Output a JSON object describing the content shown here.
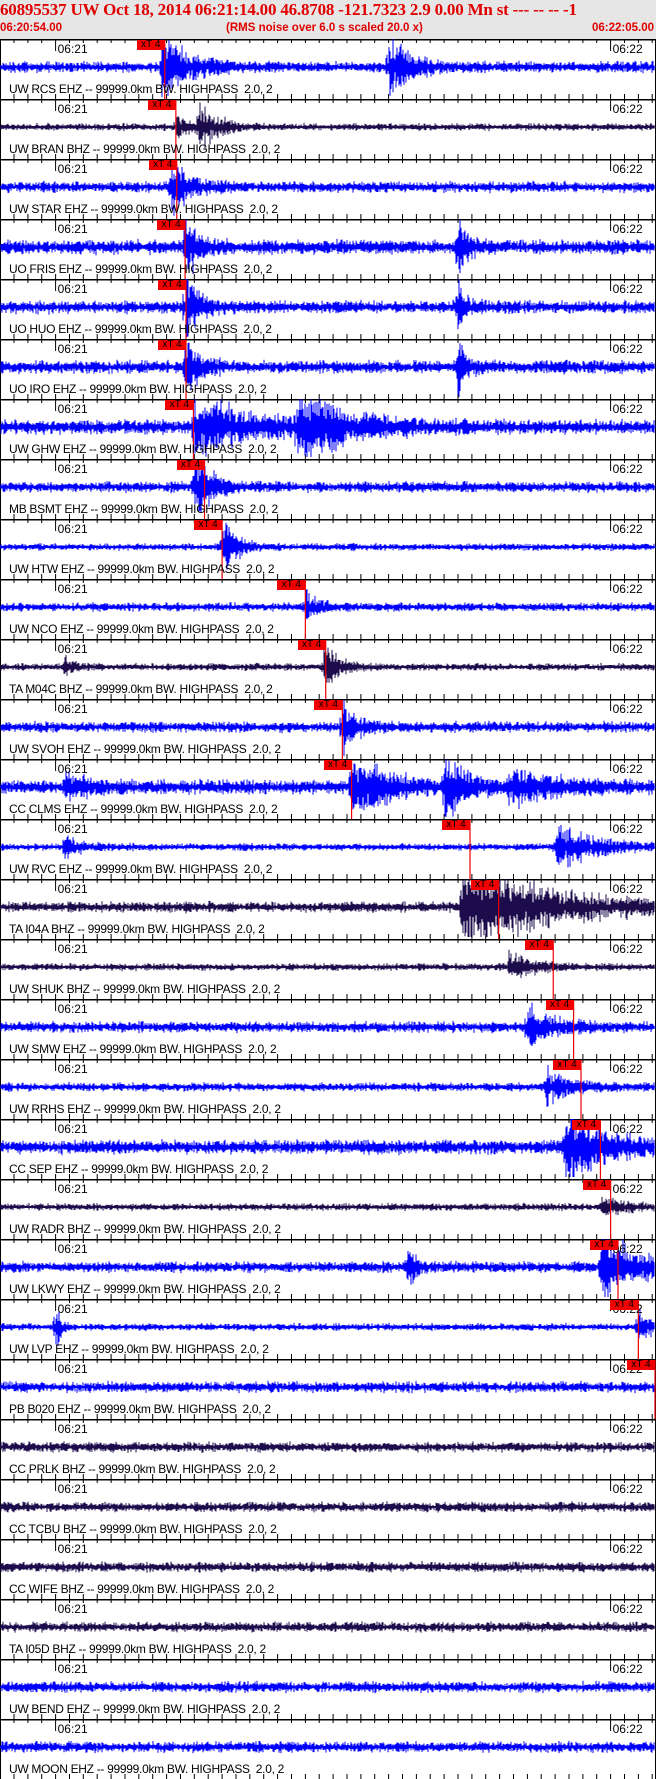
{
  "header": {
    "title": "60895537 UW Oct 18, 2014 06:21:14.00   46.8708 -121.7323  2.9 0.00 Mn st --- -- --  -1",
    "start_time": "06:20:54.00",
    "note": "(RMS noise over 6.0 s scaled 20.0 x)",
    "end_time": "06:22:05.00"
  },
  "chart_data": {
    "type": "line",
    "title": "60895537 UW Oct 18, 2014 06:21:14.00",
    "x_unit": "seconds after 06:20:54.00",
    "xlim": [
      0,
      71
    ],
    "tick_labels": [
      {
        "label": "06:21",
        "t": 6
      },
      {
        "label": "06:22",
        "t": 66
      }
    ],
    "pick_label": "xT 4",
    "colors": {
      "EHZ": "#0000ff",
      "BHZ": "#1c0c4c",
      "pick": "#f00000"
    },
    "suffix": " -- 99999.0km BW. HIGHPASS  2.0, 2",
    "traces": [
      {
        "station": "UW RCS EHZ",
        "ch": "EHZ",
        "pick": 17.8,
        "noise": 0.15,
        "events": [
          [
            17.5,
            1.0,
            6
          ],
          [
            42,
            0.8,
            5
          ]
        ]
      },
      {
        "station": "UW BRAN BHZ",
        "ch": "BHZ",
        "pick": 19.0,
        "noise": 0.1,
        "events": [
          [
            19,
            0.3,
            4
          ],
          [
            21.5,
            0.7,
            4
          ]
        ]
      },
      {
        "station": "UW STAR EHZ",
        "ch": "EHZ",
        "pick": 19.1,
        "noise": 0.15,
        "events": [
          [
            18.5,
            0.9,
            4
          ]
        ]
      },
      {
        "station": "UO FRIS EHZ",
        "ch": "EHZ",
        "pick": 20.0,
        "noise": 0.2,
        "events": [
          [
            20,
            1.0,
            3
          ],
          [
            49.5,
            0.8,
            2
          ]
        ]
      },
      {
        "station": "UO HUO EHZ",
        "ch": "EHZ",
        "pick": 20.1,
        "noise": 0.18,
        "events": [
          [
            20,
            1.0,
            3
          ],
          [
            49.5,
            0.7,
            2
          ]
        ]
      },
      {
        "station": "UO IRO EHZ",
        "ch": "EHZ",
        "pick": 20.1,
        "noise": 0.18,
        "events": [
          [
            20,
            1.0,
            3
          ],
          [
            49.5,
            1.0,
            2
          ]
        ]
      },
      {
        "station": "UW GHW EHZ",
        "ch": "EHZ",
        "pick": 20.9,
        "noise": 0.2,
        "events": [
          [
            21,
            0.9,
            12
          ],
          [
            32,
            0.9,
            12
          ]
        ]
      },
      {
        "station": "MB BSMT EHZ",
        "ch": "EHZ",
        "pick": 22.1,
        "noise": 0.15,
        "events": [
          [
            21,
            1.0,
            4
          ]
        ]
      },
      {
        "station": "UW HTW EHZ",
        "ch": "EHZ",
        "pick": 24.0,
        "noise": 0.1,
        "events": [
          [
            24,
            0.8,
            3
          ]
        ]
      },
      {
        "station": "UW NCO EHZ",
        "ch": "EHZ",
        "pick": 33.0,
        "noise": 0.12,
        "events": [
          [
            33,
            0.4,
            3
          ]
        ]
      },
      {
        "station": "TA M04C BHZ",
        "ch": "BHZ",
        "pick": 35.2,
        "noise": 0.1,
        "events": [
          [
            7,
            0.3,
            2
          ],
          [
            35,
            0.7,
            3
          ]
        ]
      },
      {
        "station": "UW SVOH EHZ",
        "ch": "EHZ",
        "pick": 37.0,
        "noise": 0.15,
        "events": [
          [
            37,
            0.6,
            4
          ]
        ]
      },
      {
        "station": "CC CLMS EHZ",
        "ch": "EHZ",
        "pick": 38.0,
        "noise": 0.2,
        "events": [
          [
            7,
            0.4,
            5
          ],
          [
            38,
            0.9,
            8
          ],
          [
            48,
            1.0,
            5
          ],
          [
            55,
            0.4,
            10
          ]
        ]
      },
      {
        "station": "UW RVC EHZ",
        "ch": "EHZ",
        "pick": 50.8,
        "noise": 0.1,
        "events": [
          [
            7,
            0.3,
            4
          ],
          [
            60,
            0.6,
            10
          ]
        ]
      },
      {
        "station": "TA I04A BHZ",
        "ch": "BHZ",
        "pick": 53.9,
        "noise": 0.15,
        "events": [
          [
            50,
            1.2,
            20
          ]
        ]
      },
      {
        "station": "UW SHUK BHZ",
        "ch": "BHZ",
        "pick": 59.8,
        "noise": 0.1,
        "events": [
          [
            55,
            0.4,
            6
          ]
        ]
      },
      {
        "station": "UW SMW EHZ",
        "ch": "EHZ",
        "pick": 62.0,
        "noise": 0.15,
        "events": [
          [
            57,
            0.6,
            6
          ]
        ]
      },
      {
        "station": "UW RRHS EHZ",
        "ch": "EHZ",
        "pick": 62.8,
        "noise": 0.12,
        "events": [
          [
            59,
            0.5,
            5
          ]
        ]
      },
      {
        "station": "CC SEP EHZ",
        "ch": "EHZ",
        "pick": 64.9,
        "noise": 0.2,
        "events": [
          [
            61,
            1.0,
            10
          ]
        ]
      },
      {
        "station": "UW RADR BHZ",
        "ch": "BHZ",
        "pick": 66.0,
        "noise": 0.1,
        "events": [
          [
            65,
            0.3,
            5
          ]
        ]
      },
      {
        "station": "UW LKWY EHZ",
        "ch": "EHZ",
        "pick": 66.8,
        "noise": 0.15,
        "events": [
          [
            44,
            0.6,
            2
          ],
          [
            65,
            1.0,
            8
          ]
        ]
      },
      {
        "station": "UW LVP EHZ",
        "ch": "EHZ",
        "pick": 69.0,
        "noise": 0.1,
        "events": [
          [
            6,
            0.9,
            1
          ],
          [
            69,
            0.5,
            3
          ]
        ]
      },
      {
        "station": "PB B020 EHZ",
        "ch": "EHZ",
        "pick": 70.8,
        "noise": 0.15,
        "events": []
      },
      {
        "station": "CC PRLK BHZ",
        "ch": "BHZ",
        "pick": null,
        "noise": 0.14,
        "events": []
      },
      {
        "station": "CC TCBU BHZ",
        "ch": "BHZ",
        "pick": null,
        "noise": 0.14,
        "events": []
      },
      {
        "station": "CC WIFE BHZ",
        "ch": "BHZ",
        "pick": null,
        "noise": 0.14,
        "events": []
      },
      {
        "station": "TA I05D BHZ",
        "ch": "BHZ",
        "pick": null,
        "noise": 0.14,
        "events": []
      },
      {
        "station": "UW BEND EHZ",
        "ch": "EHZ",
        "pick": null,
        "noise": 0.15,
        "events": []
      },
      {
        "station": "UW MOON EHZ",
        "ch": "EHZ",
        "pick": null,
        "noise": 0.15,
        "events": []
      }
    ]
  }
}
